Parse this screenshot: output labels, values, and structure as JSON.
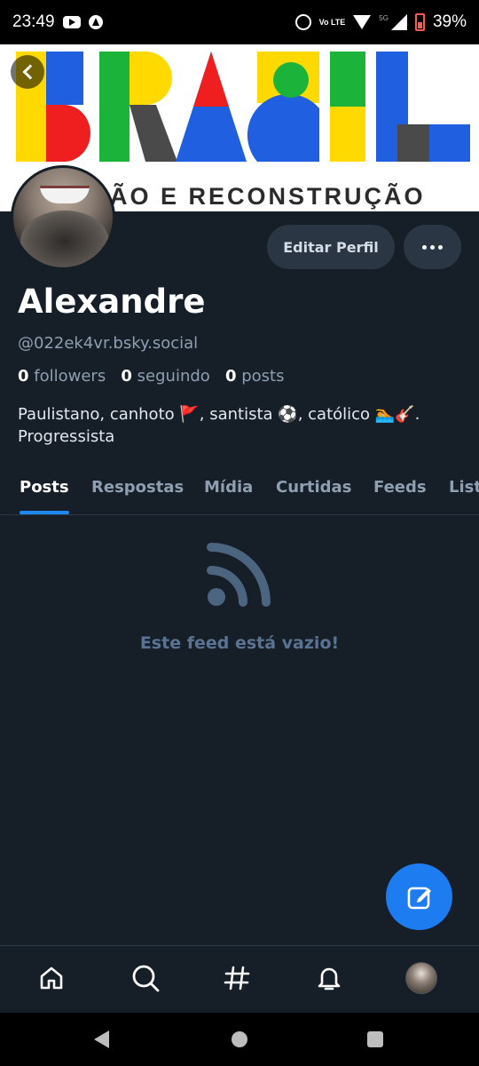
{
  "status_bar": {
    "time": "23:49",
    "battery_text": "39%",
    "network_label": "5G",
    "volte_label": "Vo LTE",
    "icons": [
      "youtube-icon",
      "a-app-icon",
      "alarm-icon",
      "volte-icon",
      "wifi-icon",
      "signal-icon",
      "battery-icon"
    ]
  },
  "banner": {
    "wordmark": "BRASIL",
    "subtitle": "ÃO E RECONSTRUÇÃO",
    "colors": {
      "blue": "#1f5fe0",
      "green": "#1bb33a",
      "yellow": "#ffd900",
      "red": "#ef1f1f",
      "dark": "#4a4a4a"
    }
  },
  "profile": {
    "display_name": "Alexandre",
    "handle": "@022ek4vr.bsky.social",
    "followers_count": "0",
    "followers_label": "followers",
    "following_count": "0",
    "following_label": "seguindo",
    "posts_count": "0",
    "posts_label": "posts",
    "bio_line1": "Paulistano, canhoto 🚩, santista ⚽, católico 🏊🎸.",
    "bio_line2": "Progressista"
  },
  "actions": {
    "edit_label": "Editar Perfil"
  },
  "tabs": [
    {
      "label": "Posts",
      "active": true
    },
    {
      "label": "Respostas",
      "active": false
    },
    {
      "label": "Mídia",
      "active": false
    },
    {
      "label": "Curtidas",
      "active": false
    },
    {
      "label": "Feeds",
      "active": false
    },
    {
      "label": "Listas",
      "active": false
    }
  ],
  "feed": {
    "empty_text": "Este feed está vazio!"
  },
  "bottom_nav": [
    "home-icon",
    "search-icon",
    "hashtag-icon",
    "notifications-icon",
    "profile-avatar"
  ],
  "theme": {
    "background": "#161e27",
    "accent": "#1d7cf0",
    "muted_text": "#8f9fb2",
    "empty_text": "#5b7392"
  }
}
